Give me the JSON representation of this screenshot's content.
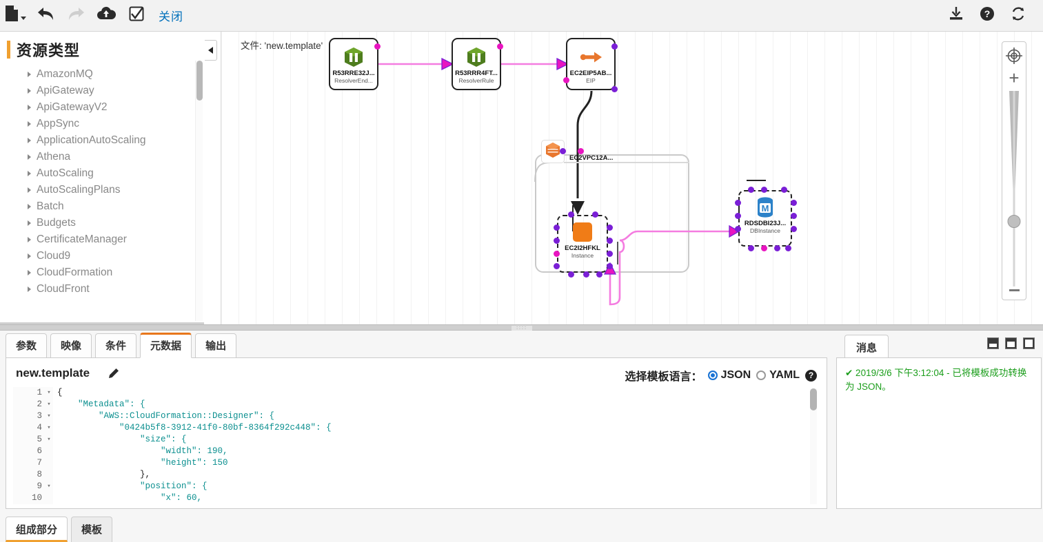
{
  "toolbar": {
    "file_icon": "file-icon",
    "undo_icon": "undo-arrow-icon",
    "redo_icon": "redo-arrow-icon",
    "upload_icon": "cloud-upload-icon",
    "validate_icon": "checkbox-check-icon",
    "close_label": "关闭",
    "download_icon": "download-icon",
    "help_icon": "question-help-icon",
    "refresh_icon": "refresh-icon"
  },
  "sidebar": {
    "title": "资源类型",
    "items": [
      {
        "label": "AmazonMQ"
      },
      {
        "label": "ApiGateway"
      },
      {
        "label": "ApiGatewayV2"
      },
      {
        "label": "AppSync"
      },
      {
        "label": "ApplicationAutoScaling"
      },
      {
        "label": "Athena"
      },
      {
        "label": "AutoScaling"
      },
      {
        "label": "AutoScalingPlans"
      },
      {
        "label": "Batch"
      },
      {
        "label": "Budgets"
      },
      {
        "label": "CertificateManager"
      },
      {
        "label": "Cloud9"
      },
      {
        "label": "CloudFormation"
      },
      {
        "label": "CloudFront"
      }
    ]
  },
  "canvas": {
    "file_label": "文件: 'new.template'",
    "nodes": [
      {
        "id": "r53endpoint",
        "name": "R53RRE32J...",
        "type": "ResolverEnd...",
        "icon": "route53-resolver-endpoint-icon"
      },
      {
        "id": "r53rule",
        "name": "R53RRR4FT...",
        "type": "ResolverRule",
        "icon": "route53-resolver-rule-icon"
      },
      {
        "id": "ec2eip",
        "name": "EC2EIP5AB...",
        "type": "EIP",
        "icon": "elastic-ip-icon"
      },
      {
        "id": "ec2instance",
        "name": "EC2I2HFKL",
        "type": "Instance",
        "icon": "ec2-instance-icon"
      },
      {
        "id": "rdsdb",
        "name": "RDSDBI23J...",
        "type": "DBInstance",
        "icon": "rds-database-icon"
      }
    ],
    "vpc": {
      "label": "EC2VPC12A...",
      "icon": "vpc-icon"
    },
    "zoom_control": {
      "fit_icon": "fit-to-screen-icon",
      "plus_label": "+",
      "minus_icon": "minus-icon"
    },
    "collapse_icon": "collapse-left-arrow-icon"
  },
  "editor": {
    "tabs": [
      {
        "label": "参数",
        "active": false
      },
      {
        "label": "映像",
        "active": false
      },
      {
        "label": "条件",
        "active": false
      },
      {
        "label": "元数据",
        "active": true
      },
      {
        "label": "输出",
        "active": false
      }
    ],
    "template_name": "new.template",
    "edit_icon": "pencil-edit-icon",
    "lang_label": "选择模板语言：",
    "lang_options": [
      {
        "label": "JSON",
        "selected": true
      },
      {
        "label": "YAML",
        "selected": false
      }
    ],
    "lang_help_icon": "question-help-icon",
    "code_lines": [
      {
        "n": "1",
        "fold": "▾",
        "text": "{"
      },
      {
        "n": "2",
        "fold": "▾",
        "text": "    \"Metadata\": {"
      },
      {
        "n": "3",
        "fold": "▾",
        "text": "        \"AWS::CloudFormation::Designer\": {"
      },
      {
        "n": "4",
        "fold": "▾",
        "text": "            \"0424b5f8-3912-41f0-80bf-8364f292c448\": {"
      },
      {
        "n": "5",
        "fold": "▾",
        "text": "                \"size\": {"
      },
      {
        "n": "6",
        "fold": "",
        "text": "                    \"width\": 190,"
      },
      {
        "n": "7",
        "fold": "",
        "text": "                    \"height\": 150"
      },
      {
        "n": "8",
        "fold": "",
        "text": "                },"
      },
      {
        "n": "9",
        "fold": "▾",
        "text": "                \"position\": {"
      },
      {
        "n": "10",
        "fold": "",
        "text": "                    \"x\": 60,"
      }
    ]
  },
  "messages": {
    "tab_label": "消息",
    "entry": "✔ 2019/3/6 下午3:12:04 - 已将模板成功转换为 JSON。",
    "win_buttons": [
      "panel-size-small-icon",
      "panel-size-medium-icon",
      "panel-size-large-icon"
    ]
  },
  "bottom_tabs": [
    {
      "label": "组成部分",
      "active": true
    },
    {
      "label": "模板",
      "active": false
    }
  ],
  "colors": {
    "accent_orange": "#f0a030",
    "tab_active_orange": "#e8761b",
    "link_blue": "#0070bb",
    "success_green": "#1a9d1a",
    "port_purple": "#7a1fd6",
    "port_pink": "#e815c0",
    "edge_pink": "#f47ce0",
    "radio_blue": "#1a73d4"
  }
}
